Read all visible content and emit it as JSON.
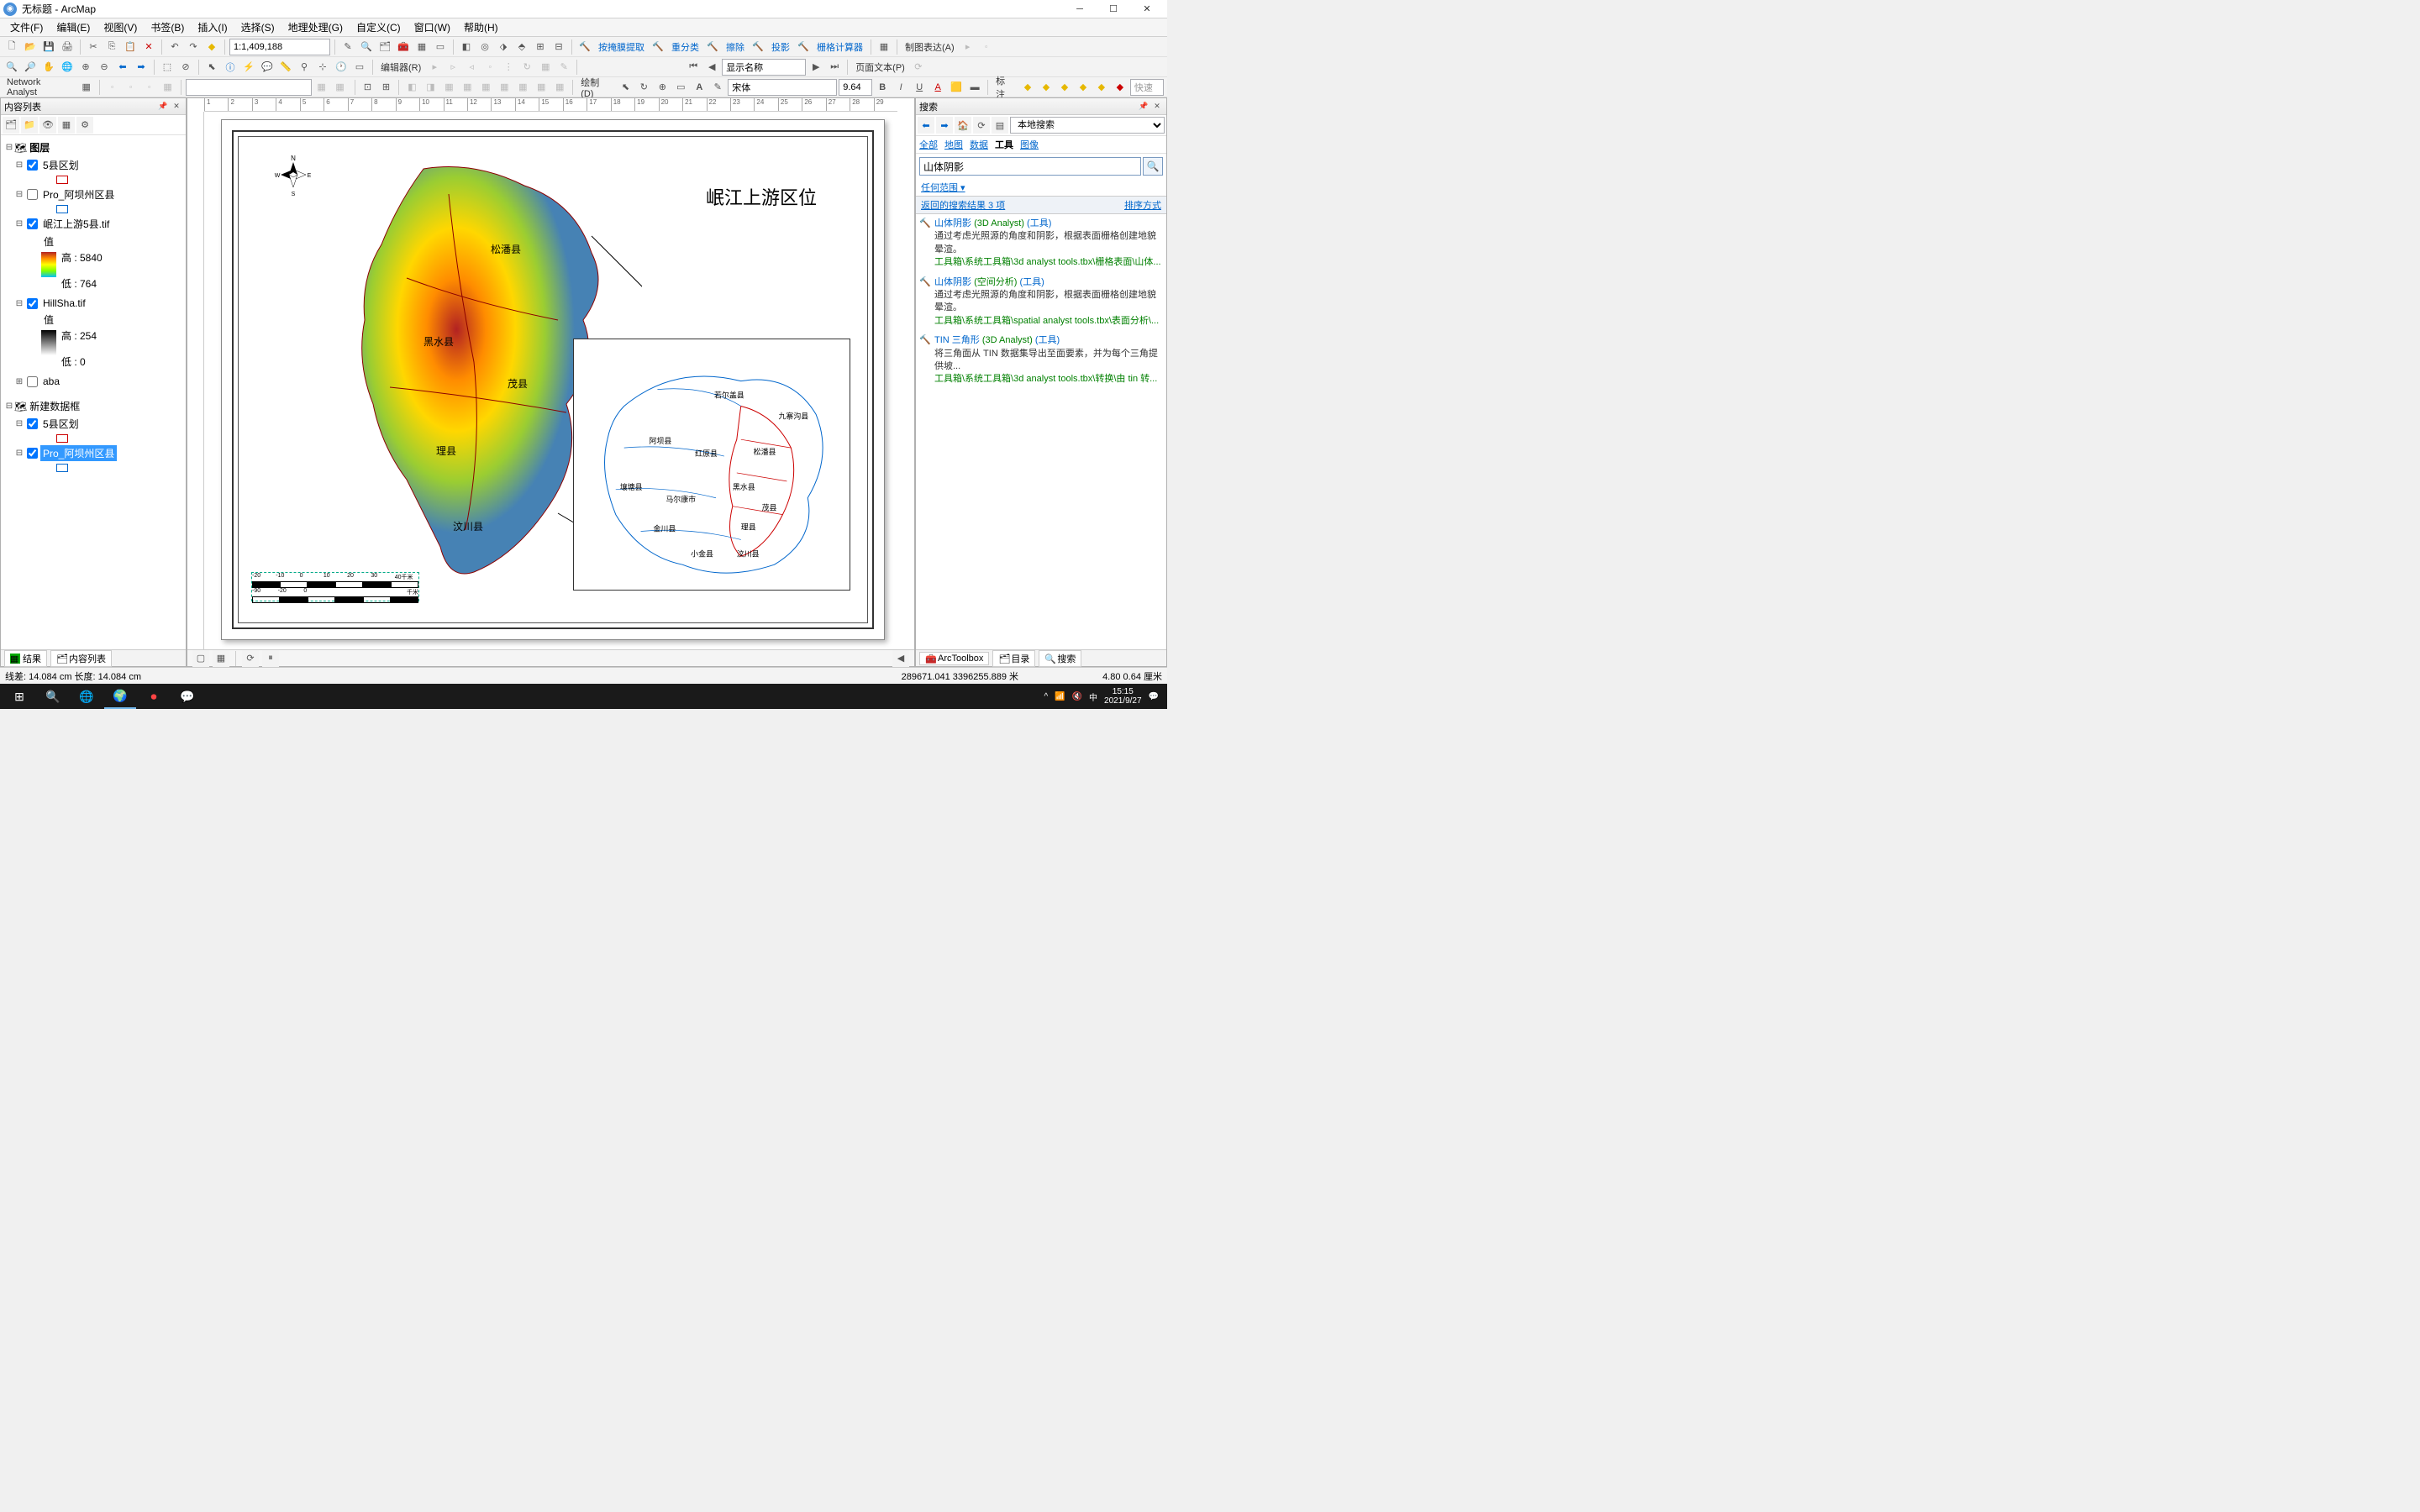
{
  "window": {
    "title": "无标题 - ArcMap"
  },
  "menu": [
    "文件(F)",
    "编辑(E)",
    "视图(V)",
    "书签(B)",
    "插入(I)",
    "选择(S)",
    "地理处理(G)",
    "自定义(C)",
    "窗口(W)",
    "帮助(H)"
  ],
  "toolbar1": {
    "scale": "1:1,409,188",
    "labels": {
      "mask": "按掩膜提取",
      "reclass": "重分类",
      "erase": "擦除",
      "project": "投影",
      "raster_calc": "栅格计算器",
      "cartorep": "制图表达(A)"
    }
  },
  "toolbar2": {
    "editor": "编辑器(R)",
    "show_name": "显示名称",
    "page_text": "页面文本(P)"
  },
  "toolbar3": {
    "na": "Network Analyst",
    "draw": "绘制(D)",
    "font": "宋体",
    "size": "9.64",
    "annotate": "标注",
    "quick": "快速"
  },
  "toc": {
    "title": "内容列表",
    "root": "图层",
    "layers": {
      "l1": "5县区划",
      "l2": "Pro_阿坝州区县",
      "l3": "岷江上游5县.tif",
      "l3_val": "值",
      "l3_high": "高 : 5840",
      "l3_low": "低 : 764",
      "l4": "HillSha.tif",
      "l4_val": "值",
      "l4_high": "高 : 254",
      "l4_low": "低 : 0",
      "l5": "aba"
    },
    "df2": "新建数据框",
    "df2_layers": {
      "l1": "5县区划",
      "l2": "Pro_阿坝州区县"
    }
  },
  "map": {
    "title": "岷江上游区位",
    "labels": {
      "songpan": "松潘县",
      "heishui": "黑水县",
      "maoxian": "茂县",
      "lixian": "理县",
      "wenchuan": "汶川县"
    },
    "inset_labels": {
      "ruoergai": "若尔盖县",
      "jiuzhaigou": "九寨沟县",
      "aba": "阿坝县",
      "hongyuan": "红原县",
      "songpan": "松潘县",
      "rangtang": "壤塘县",
      "maerkang": "马尔康市",
      "heishui": "黑水县",
      "maoxian": "茂县",
      "jinchuan": "金川县",
      "lixian": "理县",
      "xiaojin": "小金县",
      "wenchuan": "汶川县"
    },
    "scalebar_ticks": [
      "-20",
      "-10",
      "0",
      "10",
      "20",
      "30",
      "40千米"
    ],
    "scalebar_ticks2": [
      "-90",
      "-20",
      "0",
      "",
      "",
      "",
      "千米"
    ]
  },
  "search": {
    "title": "搜索",
    "scope": "本地搜索",
    "tabs": [
      "全部",
      "地图",
      "数据",
      "工具",
      "图像"
    ],
    "active_tab": "工具",
    "query": "山体阴影",
    "filter": "任何范围",
    "status_left": "返回的搜索结果 3 项",
    "status_right": "排序方式",
    "results": [
      {
        "name": "山体阴影",
        "cat": "(3D Analyst)",
        "type": "(工具)",
        "desc": "通过考虑光照源的角度和阴影，根据表面栅格创建地貌晕渲。",
        "path": "工具箱\\系统工具箱\\3d analyst tools.tbx\\栅格表面\\山体..."
      },
      {
        "name": "山体阴影",
        "cat": "(空间分析)",
        "type": "(工具)",
        "desc": "通过考虑光照源的角度和阴影，根据表面栅格创建地貌晕渲。",
        "path": "工具箱\\系统工具箱\\spatial analyst tools.tbx\\表面分析\\..."
      },
      {
        "name": "TIN 三角形",
        "cat": "(3D Analyst)",
        "type": "(工具)",
        "desc": "将三角面从 TIN 数据集导出至面要素，并为每个三角提供坡...",
        "path": "工具箱\\系统工具箱\\3d analyst tools.tbx\\转换\\由 tin 转..."
      }
    ]
  },
  "bottom_left_tabs": {
    "results": "结果",
    "toc": "内容列表"
  },
  "bottom_right_tabs": {
    "arctoolbox": "ArcToolbox",
    "catalog": "目录",
    "search": "搜索"
  },
  "status": {
    "left": "线差: 14.084 cm   长度: 14.084 cm",
    "coords": "289671.041 3396255.889 米",
    "right": "4.80  0.64 厘米"
  },
  "taskbar": {
    "time": "15:15",
    "date": "2021/9/27",
    "ime": "中"
  }
}
